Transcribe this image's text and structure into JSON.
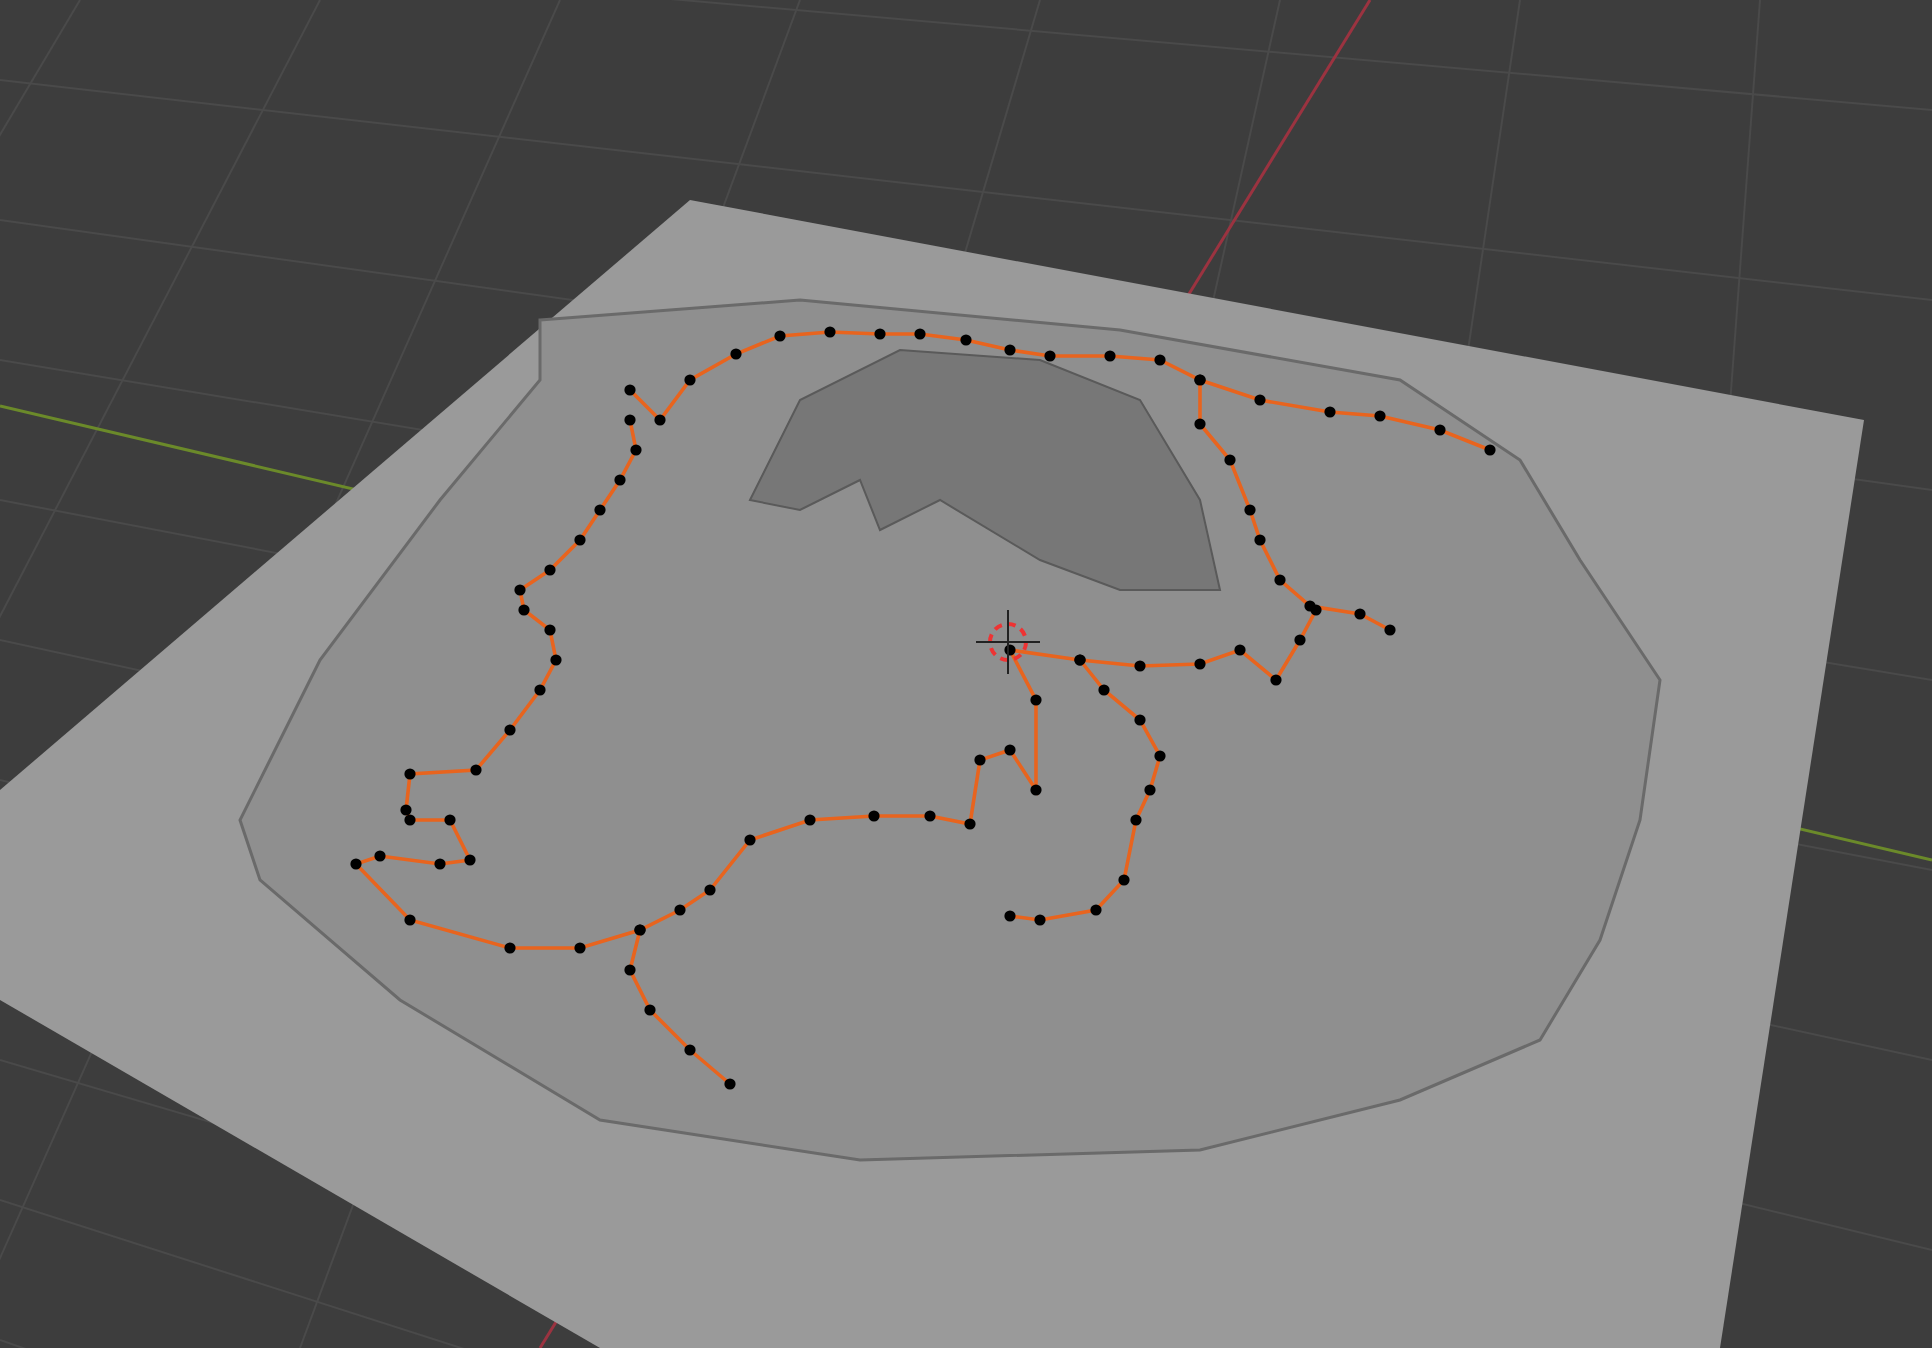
{
  "viewport": {
    "show_grid": true,
    "show_3d_cursor": true
  }
}
